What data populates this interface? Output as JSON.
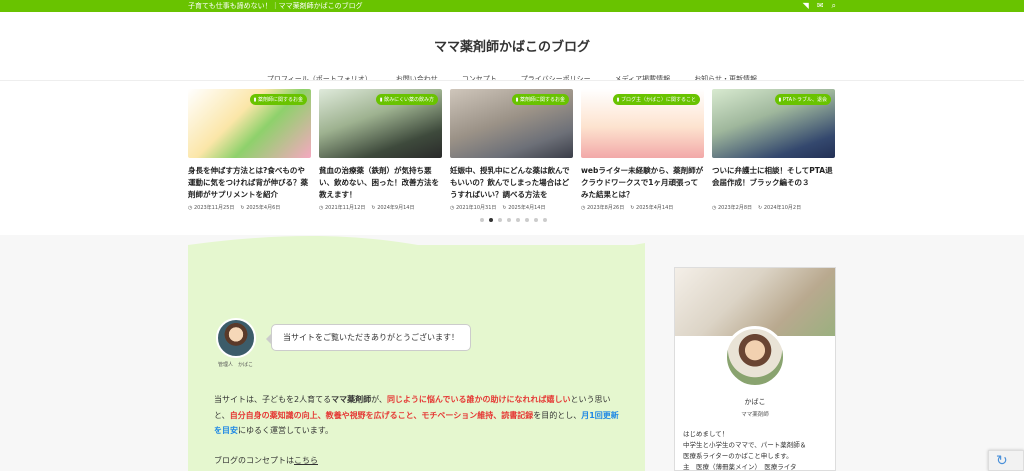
{
  "topbar": {
    "tagline": "子育ても仕事も諦めない！｜ママ薬剤師かばこのブログ"
  },
  "header": {
    "site_title": "ママ薬剤師かばこのブログ",
    "nav": [
      "プロフィール（ポートフォリオ）",
      "お問い合わせ",
      "コンセプト",
      "プライバシーポリシー",
      "メディア掲載情報",
      "お知らせ・更新情報"
    ]
  },
  "carousel": {
    "cards": [
      {
        "badge": "薬剤師に関するお金",
        "title": "身長を伸ばす方法とは?食べものや運動に気をつければ背が伸びる？薬剤師がサプリメントを紹介",
        "date": "2023年11月25日",
        "updated": "2025年4月6日"
      },
      {
        "badge": "飲みにくい薬の飲み方",
        "title": "貧血の治療薬（鉄剤）が気持ち悪い、飲めない、困った！改善方法を教えます！",
        "date": "2021年11月12日",
        "updated": "2024年9月14日"
      },
      {
        "badge": "薬剤師に関するお金",
        "title": "妊娠中、授乳中にどんな薬は飲んでもいいの？飲んでしまった場合はどうすればいい？調べる方法を",
        "date": "2021年10月31日",
        "updated": "2025年4月14日"
      },
      {
        "badge": "ブログ主（かばこ）に関すること",
        "title": "webライター未経験から、薬剤師がクラウドワークスで1ヶ月頑張ってみた結果とは？",
        "date": "2023年8月26日",
        "updated": "2025年4月14日"
      },
      {
        "badge": "PTAトラブル、退会",
        "title": "ついに弁護士に相談！そしてPTA退会届作成！ブラック編その３",
        "date": "2023年2月8日",
        "updated": "2024年10月2日"
      }
    ]
  },
  "main": {
    "avatar_name": "管理人　かばこ",
    "bubble": "当サイトをご覧いただきありがとうございます！",
    "intro": {
      "p1": "当サイトは、子どもを2人育てる",
      "p2": "ママ薬剤師",
      "p3": "が、",
      "p4": "同じように悩んでいる誰かの助けになれれば嬉しい",
      "p5": "という思いと、",
      "p6": "自分自身の薬知識の向上、教養や視野を広げること、モチベーション維持、読書記録",
      "p7": "を目的とし、",
      "p8": "月1回更新を目安",
      "p9": "にゆるく運営しています。"
    },
    "concept_text": "ブログのコンセプトは",
    "concept_link": "こちら"
  },
  "sidebar": {
    "name": "かばこ",
    "role": "ママ薬剤師",
    "bio": [
      "はじめまして！",
      "中学生と小学生のママで、パート薬剤師＆",
      "医療系ライターのかばこと申します。",
      "主　医療（薄冊薬メイン）　医療ライタ"
    ]
  },
  "colors": {
    "accent": "#69c300",
    "main_bg": "#e5f7cf",
    "red": "#e53935",
    "blue": "#1e88e5"
  }
}
